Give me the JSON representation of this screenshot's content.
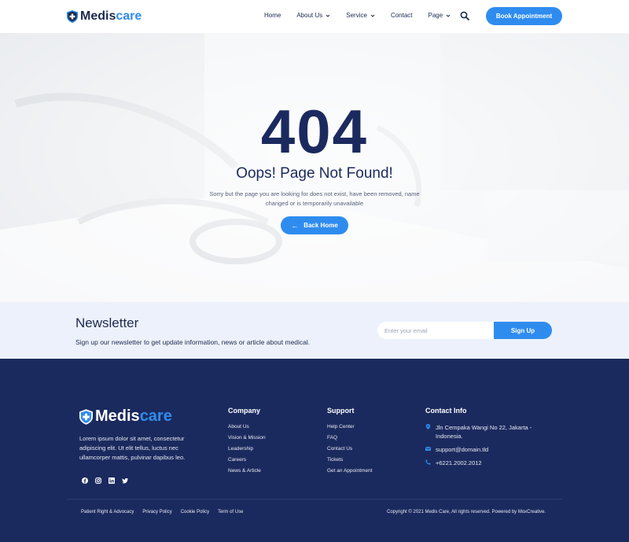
{
  "header": {
    "logo_part1": "Medis",
    "logo_part2": "care",
    "nav": [
      "Home",
      "About Us",
      "Service",
      "Contact",
      "Page"
    ],
    "book_label": "Book Appointment"
  },
  "hero": {
    "code": "404",
    "heading": "Oops! Page Not Found!",
    "description": "Sorry but the page you are looking for does not exist, have been removed, name changed or is temporarily unavailable",
    "back_label": "Back Home"
  },
  "newsletter": {
    "title": "Newsletter",
    "description": "Sign up our newsletter to get update information, news or article about medical.",
    "placeholder": "Enter your email",
    "button": "Sign Up"
  },
  "footer": {
    "logo_part1": "Medis",
    "logo_part2": "care",
    "about": "Lorem ipsum dolor sit amet, consectetur adipiscing elit. Ut elit tellus, luctus nec ullamcorper mattis, pulvinar dapibus leo.",
    "company_title": "Company",
    "company_links": [
      "About Us",
      "Vision & Mission",
      "Leadership",
      "Careers",
      "News & Article"
    ],
    "support_title": "Support",
    "support_links": [
      "Help Center",
      "FAQ",
      "Contact Us",
      "Tickets",
      "Get an Appointment"
    ],
    "contact_title": "Contact Info",
    "address": "Jln Cempaka Wangi No 22, Jakarta - Indonesia.",
    "email": "support@domain.tld",
    "phone": "+6221.2002.2012",
    "legal_links": [
      "Patient Right & Advocacy",
      "Privacy Policy",
      "Cookie Policy",
      "Term of Use"
    ],
    "copyright": "Copyright © 2021 Medis Care, All rights reserved. Powered by MoxCreative."
  },
  "colors": {
    "accent": "#2f8cef",
    "navy": "#1b2a5e",
    "newsletter_bg": "#edf1fb"
  },
  "icons": [
    "shield-cross-icon",
    "chevron-down-icon",
    "search-icon",
    "arrow-left-icon",
    "facebook-icon",
    "instagram-icon",
    "linkedin-icon",
    "twitter-icon",
    "location-pin-icon",
    "mail-icon",
    "phone-icon"
  ]
}
